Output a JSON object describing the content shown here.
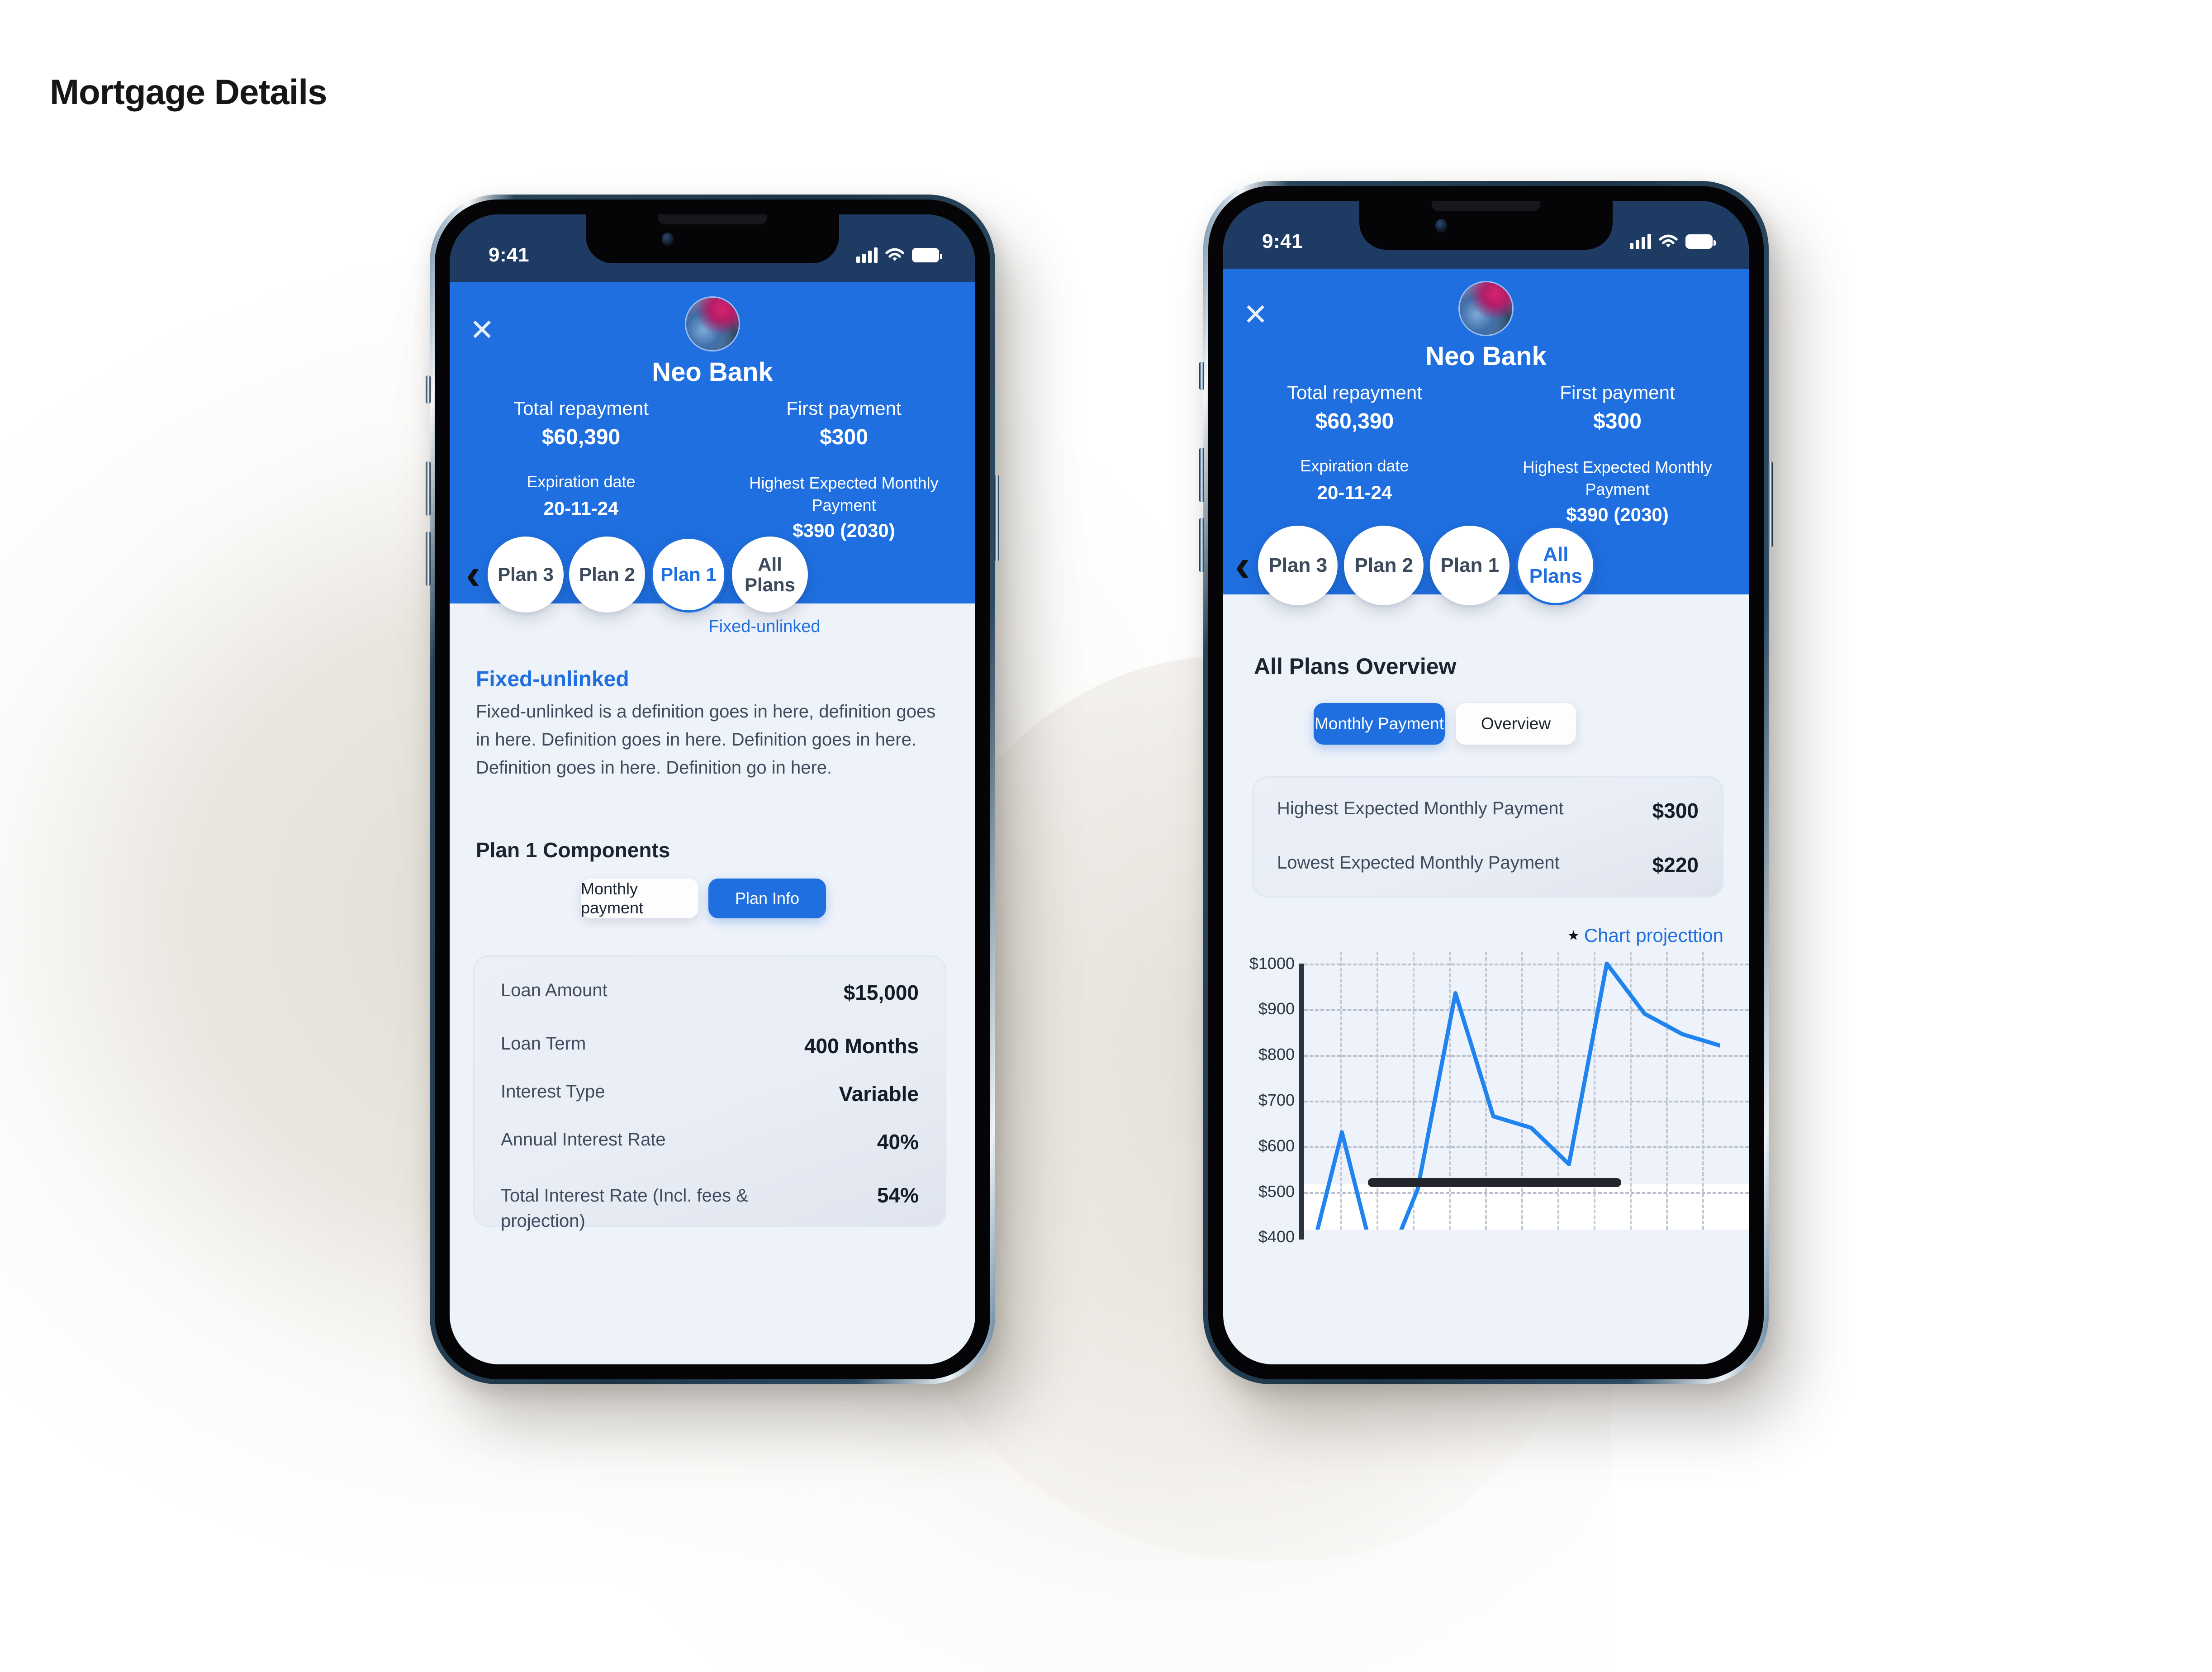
{
  "page": {
    "title": "Mortgage Details"
  },
  "status_bar": {
    "time": "9:41",
    "signal_icon": "cellular-bars-icon",
    "wifi_icon": "wifi-icon",
    "battery_icon": "battery-icon"
  },
  "brand": {
    "name": "Neo Bank",
    "accent": "#1f6fe0",
    "avatar_icon": "bank-avatar"
  },
  "close_label": "✕",
  "chevron_left": "‹",
  "phone1": {
    "header_stats": [
      {
        "label": "Total repayment",
        "value": "$60,390"
      },
      {
        "label": "First payment",
        "value": "$300"
      },
      {
        "label": "Expiration date",
        "value": "20-11-24"
      },
      {
        "label": "Highest Expected Monthly Payment",
        "value": "$390 (2030)"
      }
    ],
    "plans": [
      {
        "label": "Plan 3",
        "selected": false
      },
      {
        "label": "Plan 2",
        "selected": false
      },
      {
        "label": "Plan 1",
        "selected": true
      },
      {
        "label": "All Plans",
        "selected": false
      }
    ],
    "selected_plan_sub": "Fixed-unlinked",
    "section_title": "Fixed-unlinked",
    "section_body": "Fixed-unlinked is a definition goes in here, definition goes in here. Definition goes in here. Definition goes in here. Definition goes in here. Definition go in here.",
    "components_title": "Plan 1 Components",
    "toggles": [
      {
        "label": "Monthly payment",
        "active": false
      },
      {
        "label": "Plan Info",
        "active": true
      }
    ],
    "details": [
      {
        "key": "Loan Amount",
        "value": "$15,000"
      },
      {
        "key": "Loan Term",
        "value": "400 Months"
      },
      {
        "key": "Interest Type",
        "value": "Variable"
      },
      {
        "key": "Annual Interest Rate",
        "value": "40%"
      },
      {
        "key": "Total Interest Rate (Incl. fees & projection)",
        "value": "54%"
      }
    ]
  },
  "phone2": {
    "header_stats": [
      {
        "label": "Total repayment",
        "value": "$60,390"
      },
      {
        "label": "First payment",
        "value": "$300"
      },
      {
        "label": "Expiration date",
        "value": "20-11-24"
      },
      {
        "label": "Highest Expected Monthly Payment",
        "value": "$390 (2030)"
      }
    ],
    "plans": [
      {
        "label": "Plan 3",
        "selected": false
      },
      {
        "label": "Plan 2",
        "selected": false
      },
      {
        "label": "Plan 1",
        "selected": false
      },
      {
        "label": "All Plans",
        "selected": true
      }
    ],
    "section_title": "All Plans Overview",
    "toggles": [
      {
        "label": "Monthly Payment",
        "active": true
      },
      {
        "label": "Overview",
        "active": false
      }
    ],
    "details": [
      {
        "key": "Highest Expected Monthly Payment",
        "value": "$300"
      },
      {
        "key": "Lowest Expected Monthly Payment",
        "value": "$220"
      }
    ]
  },
  "chart_data": {
    "type": "line",
    "title": "Chart projecttion",
    "legend_marker": "★",
    "legend_position": "top-right",
    "xlabel": "",
    "ylabel": "",
    "grid": true,
    "ylim": [
      300,
      1000
    ],
    "yticks": [
      1000,
      900,
      800,
      700,
      600,
      500,
      400
    ],
    "ytick_labels": [
      "$1000",
      "$900",
      "$800",
      "$700",
      "$600",
      "$500",
      "$400"
    ],
    "line_color": "#1f84f0",
    "x": [
      0,
      1,
      2,
      3,
      4,
      5,
      6,
      7,
      8,
      9,
      10,
      11
    ],
    "values": [
      300,
      630,
      300,
      505,
      935,
      665,
      640,
      560,
      1000,
      890,
      845,
      820
    ]
  }
}
